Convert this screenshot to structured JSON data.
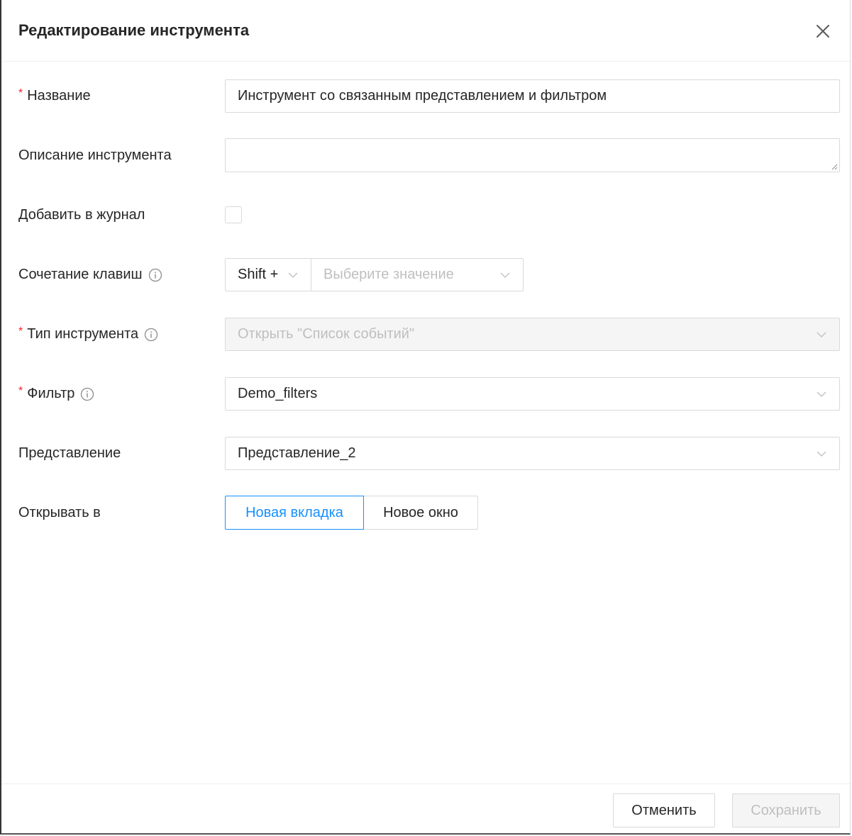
{
  "dialog": {
    "title": "Редактирование инструмента"
  },
  "form": {
    "name": {
      "label": "Название",
      "required": true,
      "value": "Инструмент со связанным представлением и фильтром"
    },
    "description": {
      "label": "Описание инструмента",
      "value": ""
    },
    "add_to_journal": {
      "label": "Добавить в журнал",
      "checked": false
    },
    "hotkey": {
      "label": "Сочетание клавиш",
      "modifier": "Shift +",
      "key_placeholder": "Выберите значение"
    },
    "tool_type": {
      "label": "Тип инструмента",
      "required": true,
      "value": "Открыть \"Список событий\"",
      "disabled": true
    },
    "filter": {
      "label": "Фильтр",
      "required": true,
      "value": "Demo_filters"
    },
    "view": {
      "label": "Представление",
      "value": "Представление_2"
    },
    "open_in": {
      "label": "Открывать в",
      "options": [
        "Новая вкладка",
        "Новое окно"
      ],
      "selected": "Новая вкладка"
    }
  },
  "footer": {
    "cancel_label": "Отменить",
    "save_label": "Сохранить"
  },
  "colors": {
    "accent": "#1890ff",
    "required": "#f5222d",
    "border": "#d9d9d9",
    "disabled_bg": "#f5f5f5",
    "placeholder": "#bfbfbf"
  }
}
